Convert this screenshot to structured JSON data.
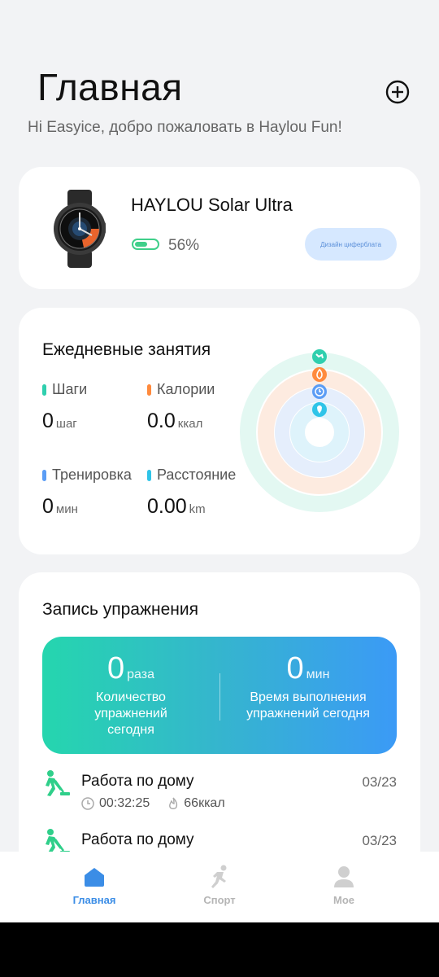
{
  "header": {
    "title": "Главная",
    "greeting": "Hi Easyice, добро пожаловать в Haylou Fun!"
  },
  "device": {
    "name": "HAYLOU Solar Ultra",
    "battery_percent": 56,
    "battery_label": "56%",
    "dial_button": "Дизайн циферблата"
  },
  "activity": {
    "title": "Ежедневные занятия",
    "stats": [
      {
        "label": "Шаги",
        "value": "0",
        "unit": "шаг",
        "color": "#2fcfae"
      },
      {
        "label": "Калории",
        "value": "0.0",
        "unit": "ккал",
        "color": "#ff8a3d"
      },
      {
        "label": "Тренировка",
        "value": "0",
        "unit": "мин",
        "color": "#5b9df5"
      },
      {
        "label": "Расстояние",
        "value": "0.00",
        "unit": "km",
        "color": "#2fc4e8"
      }
    ]
  },
  "exercise": {
    "title": "Запись упражнения",
    "count": {
      "value": "0",
      "unit": "раза",
      "label": "Количество упражнений сегодня"
    },
    "time": {
      "value": "0",
      "unit": "мин",
      "label": "Время выполнения упражнений сегодня"
    },
    "records": [
      {
        "name": "Работа по дому",
        "date": "03/23",
        "duration": "00:32:25",
        "calories": "66ккал"
      },
      {
        "name": "Работа по дому",
        "date": "03/23"
      }
    ]
  },
  "tabs": [
    {
      "label": "Главная",
      "icon": "home-icon",
      "active": true
    },
    {
      "label": "Спорт",
      "icon": "running-icon",
      "active": false
    },
    {
      "label": "Мое",
      "icon": "person-icon",
      "active": false
    }
  ],
  "colors": {
    "accent": "#3b8de6",
    "banner_start": "#25d6ae",
    "banner_end": "#3b9af6",
    "battery": "#3fcf8a"
  }
}
